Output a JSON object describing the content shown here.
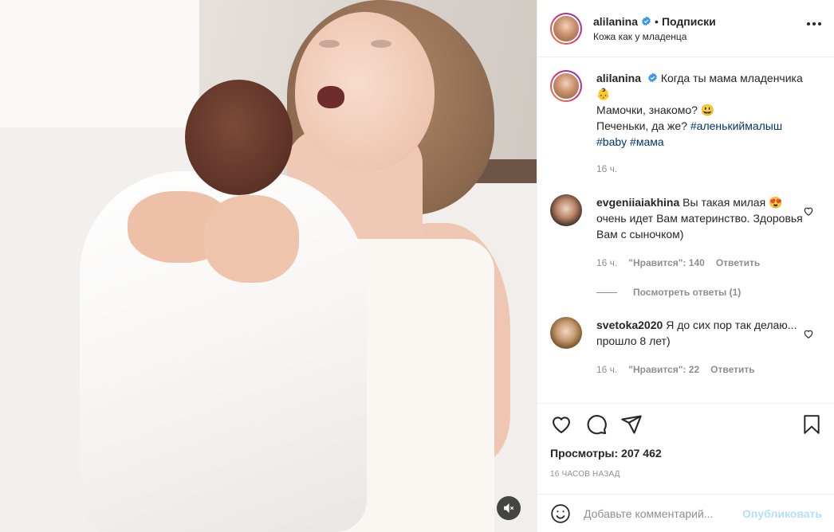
{
  "post": {
    "username": "alilanina",
    "separator": "•",
    "follow_label": "Подписки",
    "subtitle": "Кожа как у младенца"
  },
  "caption": {
    "username": "alilanina",
    "line1": "Когда ты мама младенчика 👶",
    "line2": "Мамочки, знакомо? 😃",
    "line3": "Печеньки, да же?",
    "tag1": "#аленькиймалыш",
    "tag2": "#baby",
    "tag3": "#мама",
    "time": "16 ч."
  },
  "comments": [
    {
      "username": "evgeniiaiakhina",
      "text": "Вы такая милая 😍 очень идет Вам материнство. Здоровья Вам с сыночком)",
      "time": "16 ч.",
      "likes": "\"Нравится\": 140",
      "reply": "Ответить",
      "view_replies": "Посмотреть ответы (1)"
    },
    {
      "username": "svetoka2020",
      "text": "Я до сих пор так делаю... прошло 8 лет)",
      "time": "16 ч.",
      "likes": "\"Нравится\": 22",
      "reply": "Ответить"
    }
  ],
  "stats": {
    "views": "Просмотры: 207 462",
    "posted": "16 часов назад"
  },
  "comment_box": {
    "placeholder": "Добавьте комментарий...",
    "publish": "Опубликовать"
  },
  "icons": {
    "verified": "verified-badge-icon",
    "more": "more-options-icon",
    "like": "heart-icon",
    "comment": "comment-bubble-icon",
    "share": "paper-plane-icon",
    "save": "bookmark-icon",
    "emoji": "smiley-icon",
    "mute": "muted-speaker-icon"
  },
  "colors": {
    "verified": "#3897f0",
    "link": "#00376b",
    "publish_disabled": "#b2dffc",
    "secondary": "#8e8e8e"
  }
}
